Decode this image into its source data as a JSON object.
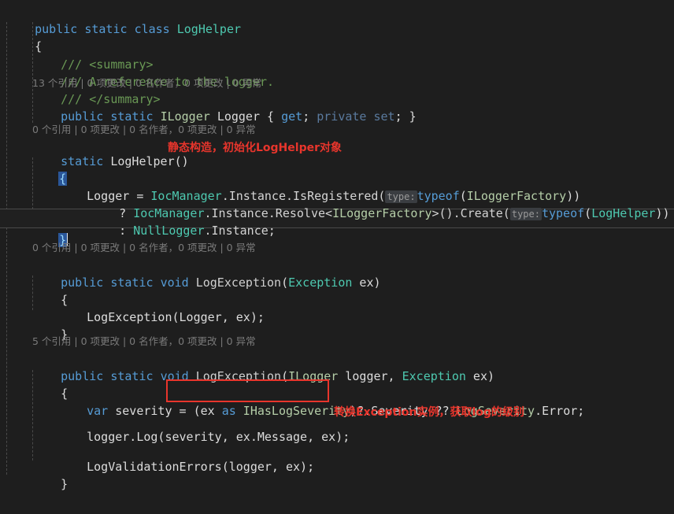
{
  "editor": {
    "background": "#1e1e1e",
    "foreground": "#dcdcdc",
    "language": "csharp"
  },
  "colors": {
    "keyword": "#569cd6",
    "keyword_dim": "#5a7a9e",
    "class_type": "#4ec9b0",
    "interface_type": "#b5cea8",
    "comment": "#6a9955",
    "plain_text": "#dcdcdc",
    "codelens_text": "#7a7a7a",
    "annotation_red": "#e8352c",
    "brace_match_bg": "#2a5699",
    "current_line_bg": "#202020",
    "param_hint_bg": "#3a3d41"
  },
  "code": {
    "line01": {
      "kw1": "public",
      "kw2": "static",
      "kw3": "class",
      "type": "LogHelper"
    },
    "line02": {
      "brace": "{"
    },
    "line03": {
      "comment": "/// <summary>"
    },
    "line04": {
      "comment": "/// A reference to the logger."
    },
    "line05": {
      "comment": "/// </summary>"
    },
    "codelens1": "13 个引用 | 0 项更改 | 0 名作者，0 项更改 | 0 异常",
    "line06": {
      "kw1": "public",
      "kw2": "static",
      "iface": "ILogger",
      "name": "Logger",
      "open": "{",
      "get": "get",
      "semi1": ";",
      "privateset": "private set",
      "semi2": ";",
      "close": "}"
    },
    "codelens2": "0 个引用 | 0 项更改 | 0 名作者，0 项更改 | 0 异常",
    "line07": {
      "kw1": "static",
      "name": "LogHelper",
      "parens": "()"
    },
    "line08": {
      "brace": "{"
    },
    "line09": {
      "name": "Logger",
      "eq": " = ",
      "type": "IocManager",
      "members": ".Instance.IsRegistered(",
      "hint": "type:",
      "kw": "typeof",
      "open": "(",
      "iface": "ILoggerFactory",
      "close": "))"
    },
    "line10": {
      "q": "? ",
      "type": "IocManager",
      "members": ".Instance.Resolve<",
      "iface": "ILoggerFactory",
      "members2": ">().Create(",
      "hint": "type:",
      "kw": "typeof",
      "open": "(",
      "type2": "LogHelper",
      "close": "))"
    },
    "line11": {
      "colon": ": ",
      "type": "NullLogger",
      "members": ".Instance;"
    },
    "line12": {
      "brace": "}"
    },
    "codelens3": "0 个引用 | 0 项更改 | 0 名作者，0 项更改 | 0 异常",
    "line13": {
      "kw1": "public",
      "kw2": "static",
      "kw3": "void",
      "name": "LogException",
      "open": "(",
      "type": "Exception",
      "param": " ex",
      "close": ")"
    },
    "line14": {
      "brace": "{"
    },
    "line15": {
      "text": "LogException(Logger, ex);"
    },
    "line16": {
      "brace": "}"
    },
    "codelens4": "5 个引用 | 0 项更改 | 0 名作者，0 项更改 | 0 异常",
    "line17": {
      "kw1": "public",
      "kw2": "static",
      "kw3": "void",
      "name": "LogException",
      "open": "(",
      "iface": "ILogger",
      "param1": " logger, ",
      "type": "Exception",
      "param2": " ex",
      "close": ")"
    },
    "line18": {
      "brace": "{"
    },
    "line19": {
      "kw": "var",
      "name": " severity = ",
      "cast_open": "(ex ",
      "cast_kw": "as",
      "cast_iface": " IHasLogSeverity",
      "cast_close": ")",
      "rest": "?.Severity ?? ",
      "type": "LogSeverity",
      "tail": ".Error;"
    },
    "line20": {
      "text": "logger.Log(severity, ex.Message, ex);"
    },
    "line21": {
      "text": "LogValidationErrors(logger, ex);"
    },
    "line22": {
      "brace": "}"
    }
  },
  "annotations": [
    {
      "id": "annot-static-ctor",
      "text": "静态构造，初始化LogHelper对象"
    },
    {
      "id": "annot-cast-exception",
      "text": "转换Exception实例，获取log的级别"
    }
  ]
}
